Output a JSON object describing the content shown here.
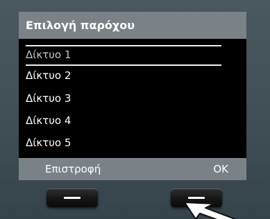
{
  "screen": {
    "title": "Επιλογή παρόχου",
    "list": [
      {
        "label": "Δίκτυο 1",
        "selected": true
      },
      {
        "label": "Δίκτυο 2",
        "selected": false
      },
      {
        "label": "Δίκτυο 3",
        "selected": false
      },
      {
        "label": "Δίκτυο 4",
        "selected": false
      },
      {
        "label": "Δίκτυο 5",
        "selected": false
      }
    ],
    "softkeys": {
      "left": "Επιστροφή",
      "right": "OK"
    }
  },
  "icons": {
    "scroll": "scroll-down-arrow-icon",
    "pointer": "pointer-arrow-icon"
  },
  "colors": {
    "screen_bg": "#000000",
    "bar_bg": "#7a8288",
    "text": "#ffffff",
    "device_bg": "#3f4d55"
  }
}
